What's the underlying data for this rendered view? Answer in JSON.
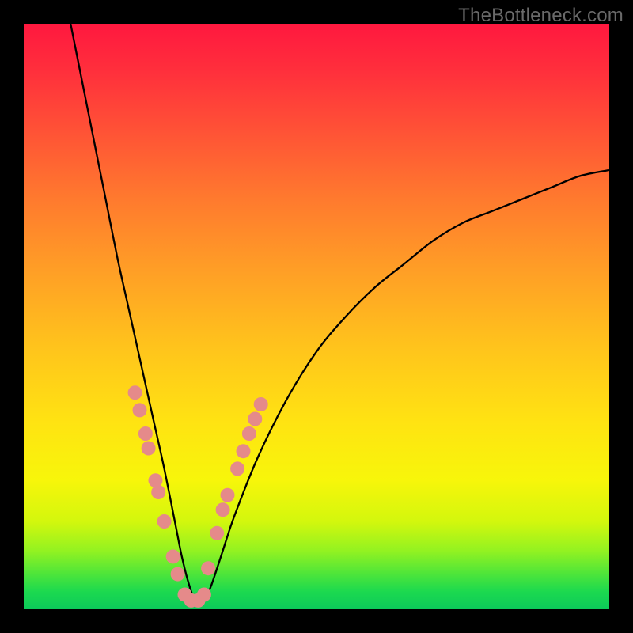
{
  "attribution": "TheBottleneck.com",
  "colors": {
    "frame": "#000000",
    "dot": "#e58a8a",
    "curve": "#000000",
    "gradient_stops": [
      {
        "pos": 0.0,
        "hex": "#ff183f"
      },
      {
        "pos": 0.08,
        "hex": "#ff2f3c"
      },
      {
        "pos": 0.18,
        "hex": "#ff5136"
      },
      {
        "pos": 0.3,
        "hex": "#ff7a2e"
      },
      {
        "pos": 0.42,
        "hex": "#ff9e26"
      },
      {
        "pos": 0.55,
        "hex": "#ffc31c"
      },
      {
        "pos": 0.68,
        "hex": "#ffe312"
      },
      {
        "pos": 0.78,
        "hex": "#f7f60a"
      },
      {
        "pos": 0.85,
        "hex": "#d3f70d"
      },
      {
        "pos": 0.9,
        "hex": "#93f221"
      },
      {
        "pos": 0.94,
        "hex": "#4de53a"
      },
      {
        "pos": 0.97,
        "hex": "#1cd94f"
      },
      {
        "pos": 1.0,
        "hex": "#0cc95a"
      }
    ]
  },
  "chart_data": {
    "type": "line",
    "title": "",
    "xlabel": "",
    "ylabel": "",
    "xlim": [
      0,
      100
    ],
    "ylim": [
      0,
      100
    ],
    "note": "V-shaped bottleneck curve. y ≈ 100 at x≈8, drops to ~0 near x≈29, rises back toward ~75 at x=100. Minimum (green zone) around x≈26–32.",
    "series": [
      {
        "name": "bottleneck-curve",
        "x": [
          8,
          10,
          12,
          14,
          16,
          18,
          20,
          22,
          24,
          26,
          27,
          28,
          29,
          30,
          31,
          32,
          34,
          36,
          40,
          45,
          50,
          55,
          60,
          65,
          70,
          75,
          80,
          85,
          90,
          95,
          100
        ],
        "y": [
          100,
          90,
          80,
          70,
          60,
          51,
          42,
          33,
          24,
          14,
          9,
          5,
          2,
          1,
          2,
          4,
          10,
          16,
          26,
          36,
          44,
          50,
          55,
          59,
          63,
          66,
          68,
          70,
          72,
          74,
          75
        ]
      },
      {
        "name": "sample-dots-left",
        "x": [
          19.0,
          19.8,
          20.8,
          21.3,
          22.5,
          23.0,
          24.0,
          25.5,
          26.3
        ],
        "y": [
          37.0,
          34.0,
          30.0,
          27.5,
          22.0,
          20.0,
          15.0,
          9.0,
          6.0
        ]
      },
      {
        "name": "sample-dots-right",
        "x": [
          31.5,
          33.0,
          34.0,
          34.8,
          36.5,
          37.5,
          38.5,
          39.5,
          40.5
        ],
        "y": [
          7.0,
          13.0,
          17.0,
          19.5,
          24.0,
          27.0,
          30.0,
          32.5,
          35.0
        ]
      },
      {
        "name": "sample-dots-bottom",
        "x": [
          27.5,
          28.6,
          29.8,
          30.8
        ],
        "y": [
          2.5,
          1.5,
          1.5,
          2.5
        ]
      }
    ]
  }
}
